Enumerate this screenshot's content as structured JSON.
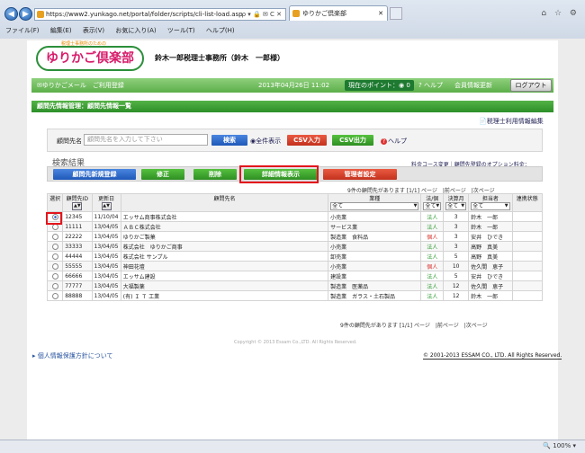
{
  "browser": {
    "url": "https://www2.yunkago.net/portal/folder/scripts/cli-list-load.asp",
    "url_icons": "ρ ▾ 🔒 ✉ C ✕",
    "tab_title": "ゆりかご倶楽部",
    "tab_close": "✕",
    "menu": [
      "ファイル(F)",
      "編集(E)",
      "表示(V)",
      "お気に入り(A)",
      "ツール(T)",
      "ヘルプ(H)"
    ],
    "win_icons": "⌂ ☆ ⚙",
    "zoom": "🔍 100%  ▾"
  },
  "site": {
    "logo": "ゆりかご倶楽部",
    "logo_sub": "税理士事務所のための",
    "office_name": "鈴木一郎税理士事務所（鈴木　一郎様）",
    "mail_link": "✉ゆりかごメール　ご利用登録",
    "datetime": "2013年04月26日 11:02",
    "points": "現在のポイント：◉ 0",
    "help": "? ヘルプ",
    "member_update": "会員情報更新",
    "logout": "ログアウト"
  },
  "page_title": "顧問先情報管理：顧問先情報一覧",
  "tax_link": "税理士利用情報編集",
  "filter": {
    "label": "顧問先名",
    "placeholder": "顧問先名を入力して下さい",
    "search": "検索",
    "show_all": "全件表示",
    "csv_in": "CSV入力",
    "csv_out": "CSV出力",
    "help": "ヘルプ"
  },
  "results": {
    "title": "検索結果",
    "links": "料金コース変更｜顧問先登録のオプション料金：",
    "actions": [
      "顧問先新規登録",
      "修正",
      "削除",
      "詳細情報表示",
      "管理者設定"
    ],
    "pager_top": "9件の顧問先があります [1/1] ページ　|前ページ　|次ページ",
    "pager_bottom": "9件の顧問先があります [1/1] ページ　|前ページ　|次ページ"
  },
  "table": {
    "headers": [
      "選択",
      "顧問先ID",
      "更新日",
      "顧問先名",
      "業種",
      "法/個",
      "決算月",
      "担当者",
      "連携状態"
    ],
    "filters": {
      "gyoshu": "全て",
      "hokan": "全て",
      "kessan": "全て",
      "tanto": "全て"
    },
    "sort": "▲▼",
    "rows": [
      {
        "id": "12345",
        "date": "11/10/04",
        "name": "エッサム商事株式会社",
        "industry": "小売業",
        "type": "法人",
        "month": "3",
        "person": "鈴木　一郎",
        "selected": true
      },
      {
        "id": "11111",
        "date": "13/04/05",
        "name": "ＡＢＣ株式会社",
        "industry": "サービス業",
        "type": "法人",
        "month": "3",
        "person": "鈴木　一郎",
        "selected": false
      },
      {
        "id": "22222",
        "date": "13/04/05",
        "name": "ゆりかご製菓",
        "industry": "製造業　食料品",
        "type": "個人",
        "month": "3",
        "person": "安井　ひでき",
        "selected": false
      },
      {
        "id": "33333",
        "date": "13/04/05",
        "name": "株式会社　ゆりかご商事",
        "industry": "小売業",
        "type": "法人",
        "month": "3",
        "person": "高野　真美",
        "selected": false
      },
      {
        "id": "44444",
        "date": "13/04/05",
        "name": "株式会社 サンプル",
        "industry": "卸売業",
        "type": "法人",
        "month": "5",
        "person": "高野　真美",
        "selected": false
      },
      {
        "id": "55555",
        "date": "13/04/05",
        "name": "神田花壇",
        "industry": "小売業",
        "type": "個人",
        "month": "10",
        "person": "佐久間　恵子",
        "selected": false
      },
      {
        "id": "66666",
        "date": "13/04/05",
        "name": "エッサム建設",
        "industry": "建設業",
        "type": "法人",
        "month": "5",
        "person": "安井　ひでき",
        "selected": false
      },
      {
        "id": "77777",
        "date": "13/04/05",
        "name": "大福製薬",
        "industry": "製造業　医薬品",
        "type": "法人",
        "month": "12",
        "person": "佐久間　恵子",
        "selected": false
      },
      {
        "id": "88888",
        "date": "13/04/05",
        "name": "(有) Ｉ Ｔ 工業",
        "industry": "製造業　ガラス・土石製品",
        "type": "法人",
        "month": "12",
        "person": "鈴木　一郎",
        "selected": false
      }
    ]
  },
  "footer": {
    "site_copy": "Copyright © 2013 Essam Co.,LTD. All Rights Reserved.",
    "privacy": "個人情報保護方針について",
    "copyright": "© 2001-2013 ESSAM CO., LTD. All Rights Reserved."
  },
  "colors": {
    "brand_green": "#2c8f28",
    "highlight_red": "#e3151c"
  }
}
